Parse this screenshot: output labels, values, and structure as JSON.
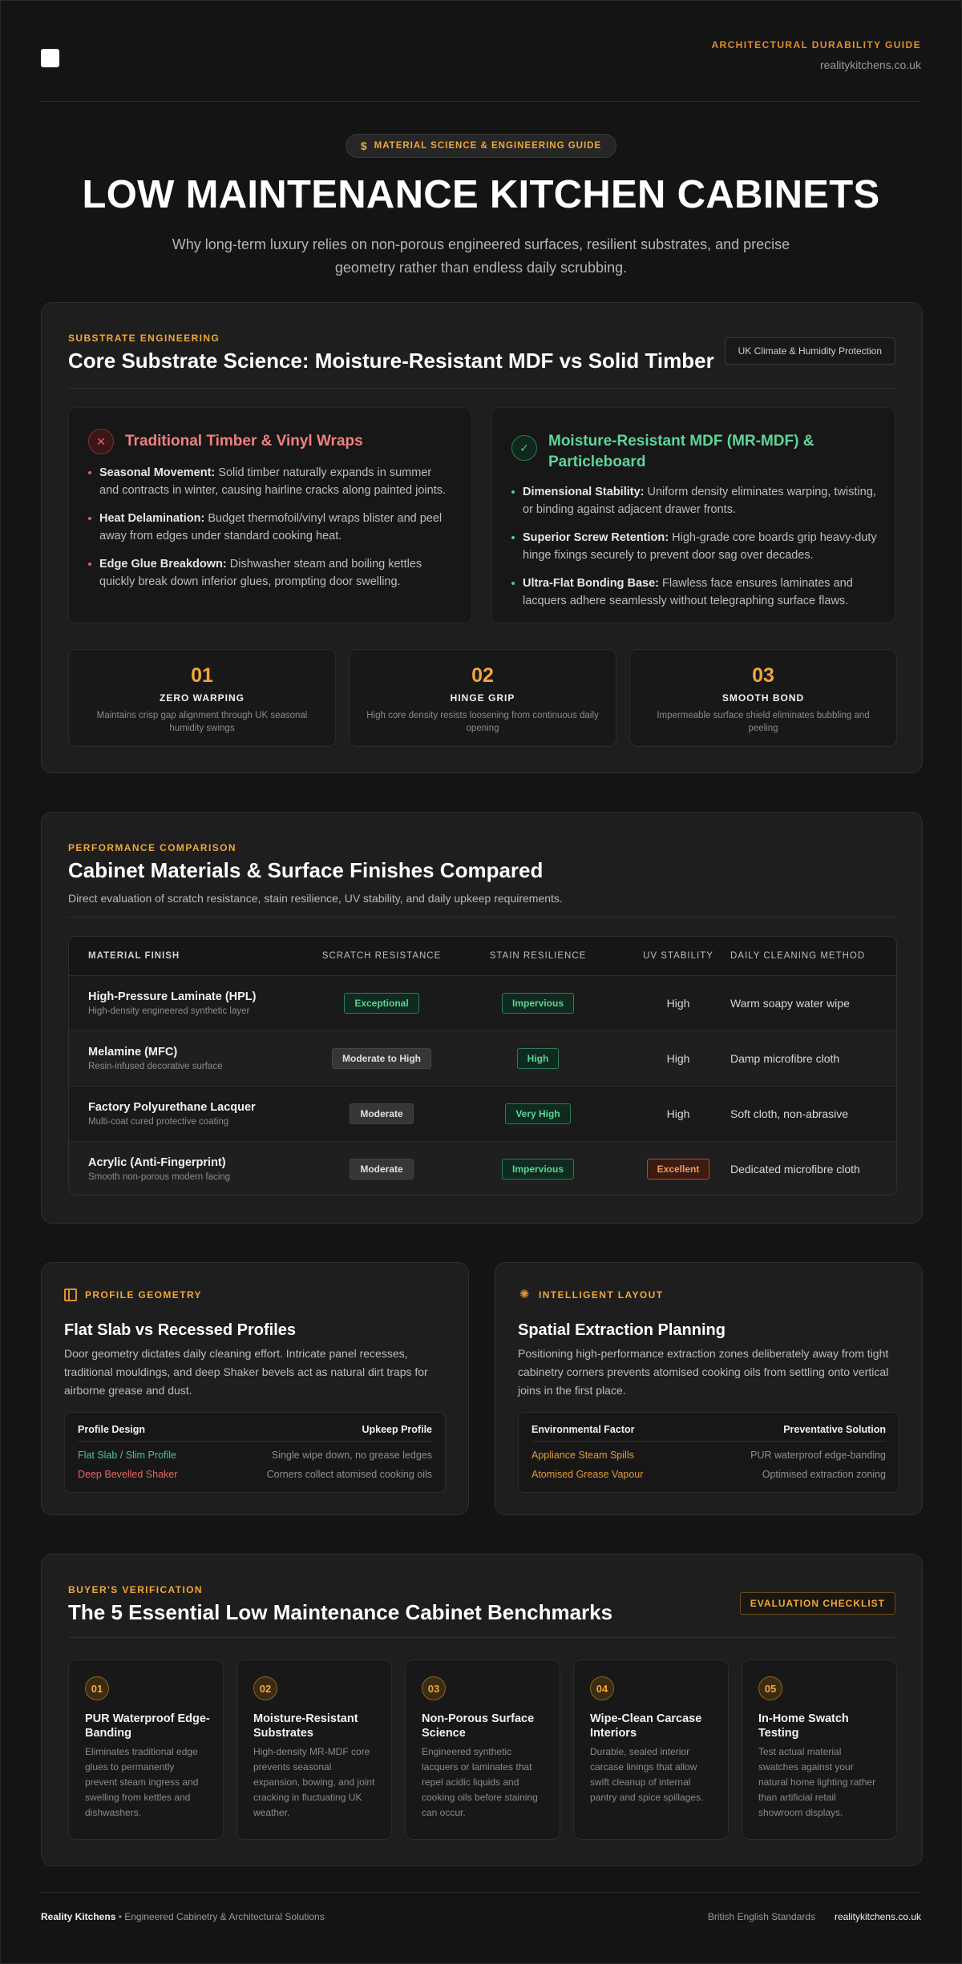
{
  "header": {
    "guide_label": "ARCHITECTURAL DURABILITY GUIDE",
    "site": "realitykitchens.co.uk",
    "logo_icon": "square-logo-icon"
  },
  "hero": {
    "pill_icon": "dollar-sign-icon",
    "pill_label": "MATERIAL SCIENCE & ENGINEERING GUIDE",
    "title": "LOW MAINTENANCE KITCHEN CABINETS",
    "subtitle": "Why long-term luxury relies on non-porous engineered surfaces, resilient substrates, and precise geometry rather than endless daily scrubbing."
  },
  "substrate": {
    "eyebrow": "SUBSTRATE ENGINEERING",
    "title": "Core Substrate Science: Moisture-Resistant MDF vs Solid Timber",
    "tag": "UK Climate & Humidity Protection",
    "bad_panel": {
      "icon": "✕",
      "title": "Traditional Timber & Vinyl Wraps",
      "items": [
        {
          "term": "Seasonal Movement:",
          "text": " Solid timber naturally expands in summer and contracts in winter, causing hairline cracks along painted joints."
        },
        {
          "term": "Heat Delamination:",
          "text": " Budget thermofoil/vinyl wraps blister and peel away from edges under standard cooking heat."
        },
        {
          "term": "Edge Glue Breakdown:",
          "text": " Dishwasher steam and boiling kettles quickly break down inferior glues, prompting door swelling."
        }
      ]
    },
    "good_panel": {
      "icon": "✓",
      "title": "Moisture-Resistant MDF (MR-MDF) & Particleboard",
      "items": [
        {
          "term": "Dimensional Stability:",
          "text": " Uniform density eliminates warping, twisting, or binding against adjacent drawer fronts."
        },
        {
          "term": "Superior Screw Retention:",
          "text": " High-grade core boards grip heavy-duty hinge fixings securely to prevent door sag over decades."
        },
        {
          "term": "Ultra-Flat Bonding Base:",
          "text": " Flawless face ensures laminates and lacquers adhere seamlessly without telegraphing surface flaws."
        }
      ]
    },
    "stats": [
      {
        "num": "01",
        "label": "ZERO WARPING",
        "desc": "Maintains crisp gap alignment through UK seasonal humidity swings"
      },
      {
        "num": "02",
        "label": "HINGE GRIP",
        "desc": "High core density resists loosening from continuous daily opening"
      },
      {
        "num": "03",
        "label": "SMOOTH BOND",
        "desc": "Impermeable surface shield eliminates bubbling and peeling"
      }
    ]
  },
  "performance": {
    "eyebrow": "PERFORMANCE COMPARISON",
    "title": "Cabinet Materials & Surface Finishes Compared",
    "subtitle": "Direct evaluation of scratch resistance, stain resilience, UV stability, and daily upkeep requirements.",
    "columns": [
      "MATERIAL FINISH",
      "SCRATCH RESISTANCE",
      "STAIN RESILIENCE",
      "UV STABILITY",
      "DAILY CLEANING METHOD"
    ],
    "rows": [
      {
        "name": "High-Pressure Laminate (HPL)",
        "sub": "High-density engineered synthetic layer",
        "scratch": "Exceptional",
        "stain": "Impervious",
        "uv": "High",
        "clean": "Warm soapy water wipe"
      },
      {
        "name": "Melamine (MFC)",
        "sub": "Resin-infused decorative surface",
        "scratch": "Moderate to High",
        "stain": "High",
        "uv": "High",
        "clean": "Damp microfibre cloth"
      },
      {
        "name": "Factory Polyurethane Lacquer",
        "sub": "Multi-coat cured protective coating",
        "scratch": "Moderate",
        "stain": "Very High",
        "uv": "High",
        "clean": "Soft cloth, non-abrasive"
      },
      {
        "name": "Acrylic (Anti-Fingerprint)",
        "sub": "Smooth non-porous modern facing",
        "scratch": "Moderate",
        "stain": "Impervious",
        "uv": "Excellent",
        "clean": "Dedicated microfibre cloth"
      }
    ]
  },
  "geometry": {
    "icon": "panel-layout-icon",
    "eyebrow": "PROFILE GEOMETRY",
    "title": "Flat Slab vs Recessed Profiles",
    "body": "Door geometry dictates daily cleaning effort. Intricate panel recesses, traditional mouldings, and deep Shaker bevels act as natural dirt traps for airborne grease and dust.",
    "head_left": "Profile Design",
    "head_right": "Upkeep Profile",
    "rows": [
      {
        "left": "Flat Slab / Slim Profile",
        "right": "Single wipe down, no grease ledges"
      },
      {
        "left": "Deep Bevelled Shaker",
        "right": "Corners collect atomised cooking oils"
      }
    ]
  },
  "layout": {
    "icon": "loader-sun-icon",
    "eyebrow": "INTELLIGENT LAYOUT",
    "title": "Spatial Extraction Planning",
    "body": "Positioning high-performance extraction zones deliberately away from tight cabinetry corners prevents atomised cooking oils from settling onto vertical joins in the first place.",
    "head_left": "Environmental Factor",
    "head_right": "Preventative Solution",
    "rows": [
      {
        "left": "Appliance Steam Spills",
        "right": "PUR waterproof edge-banding"
      },
      {
        "left": "Atomised Grease Vapour",
        "right": "Optimised extraction zoning"
      }
    ]
  },
  "checklist": {
    "eyebrow": "BUYER'S VERIFICATION",
    "title": "The 5 Essential Low Maintenance Cabinet Benchmarks",
    "tag": "EVALUATION CHECKLIST",
    "items": [
      {
        "num": "01",
        "title": "PUR Waterproof Edge-Banding",
        "desc": "Eliminates traditional edge glues to permanently prevent steam ingress and swelling from kettles and dishwashers."
      },
      {
        "num": "02",
        "title": "Moisture-Resistant Substrates",
        "desc": "High-density MR-MDF core prevents seasonal expansion, bowing, and joint cracking in fluctuating UK weather."
      },
      {
        "num": "03",
        "title": "Non-Porous Surface Science",
        "desc": "Engineered synthetic lacquers or laminates that repel acidic liquids and cooking oils before staining can occur."
      },
      {
        "num": "04",
        "title": "Wipe-Clean Carcase Interiors",
        "desc": "Durable, sealed interior carcase linings that allow swift cleanup of internal pantry and spice spillages."
      },
      {
        "num": "05",
        "title": "In-Home Swatch Testing",
        "desc": "Test actual material swatches against your natural home lighting rather than artificial retail showroom displays."
      }
    ]
  },
  "footer": {
    "brand": "Reality Kitchens",
    "tagline": " • Engineered Cabinetry & Architectural Solutions",
    "standards": "British English Standards",
    "site": "realitykitchens.co.uk"
  }
}
